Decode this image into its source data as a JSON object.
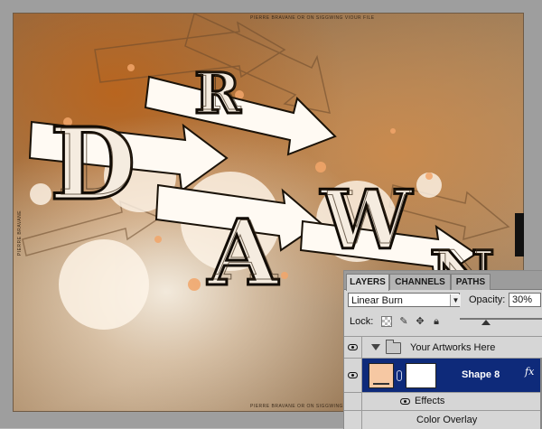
{
  "artwork": {
    "caption_top": "PIERRE BRAVANE OR ON SIGGWING VIOUR FILE",
    "caption_bottom": "PIERRE BRAVANE OR ON SIGGWING VIOUR FILE",
    "caption_left": "PIERRE BRAVANE",
    "colors": {
      "paper": "#a8855e",
      "rust": "#b8651f",
      "highlight": "#fff3e6"
    }
  },
  "layers_panel": {
    "tabs": [
      {
        "label": "LAYERS",
        "active": true
      },
      {
        "label": "CHANNELS",
        "active": false
      },
      {
        "label": "PATHS",
        "active": false
      }
    ],
    "blend_mode": "Linear Burn",
    "opacity_label": "Opacity:",
    "opacity_value": "30%",
    "lock_label": "Lock:",
    "lock_icons": [
      "lock-transparent-icon",
      "lock-brush-icon",
      "lock-move-icon",
      "lock-all-icon"
    ],
    "group": {
      "name": "Your Artworks Here",
      "visible": true
    },
    "selected_layer": {
      "name": "Shape 8",
      "visible": true,
      "thumbnail_color": "#f6c8a3",
      "fx_label": "fx"
    },
    "effects": {
      "label": "Effects",
      "items": [
        "Color Overlay"
      ]
    },
    "selection_color": "#0e2a7a"
  }
}
